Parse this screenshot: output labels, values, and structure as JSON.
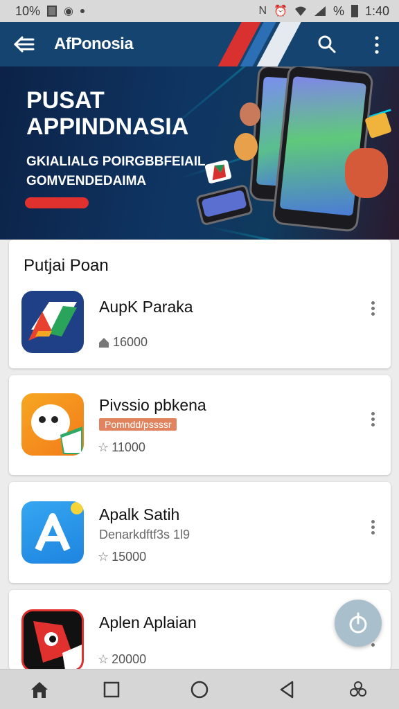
{
  "status_bar": {
    "left_text": "10%",
    "time": "1:40",
    "battery_text": "%"
  },
  "app_bar": {
    "title": "AfPonosia"
  },
  "banner": {
    "title_line1": "PUSAT",
    "title_line2": "APPINDNASIA",
    "subtitle_line1": "GKIALIALG POIRGBBFEIAIL",
    "subtitle_line2": "GOMVENDEDAIMA"
  },
  "section": {
    "title": "Putjai Poan"
  },
  "apps": [
    {
      "name": "AupK Paraka",
      "rating": "16000",
      "rating_icon": "home-icon"
    },
    {
      "name": "Pivssio pbkena",
      "badge": "Pomndd/pssssr",
      "rating": "11000",
      "rating_icon": "star-icon"
    },
    {
      "name": "Apalk Satih",
      "developer": "Denarkdftf3s 1l9",
      "rating": "15000",
      "rating_icon": "star-icon"
    },
    {
      "name": "Aplen Aplaian",
      "rating": "20000",
      "rating_icon": "star-icon"
    }
  ],
  "colors": {
    "app_bar": "#14446f",
    "accent_red": "#e0312f",
    "fab": "#a9c0cc",
    "nav_bar": "#d6d6d6"
  }
}
